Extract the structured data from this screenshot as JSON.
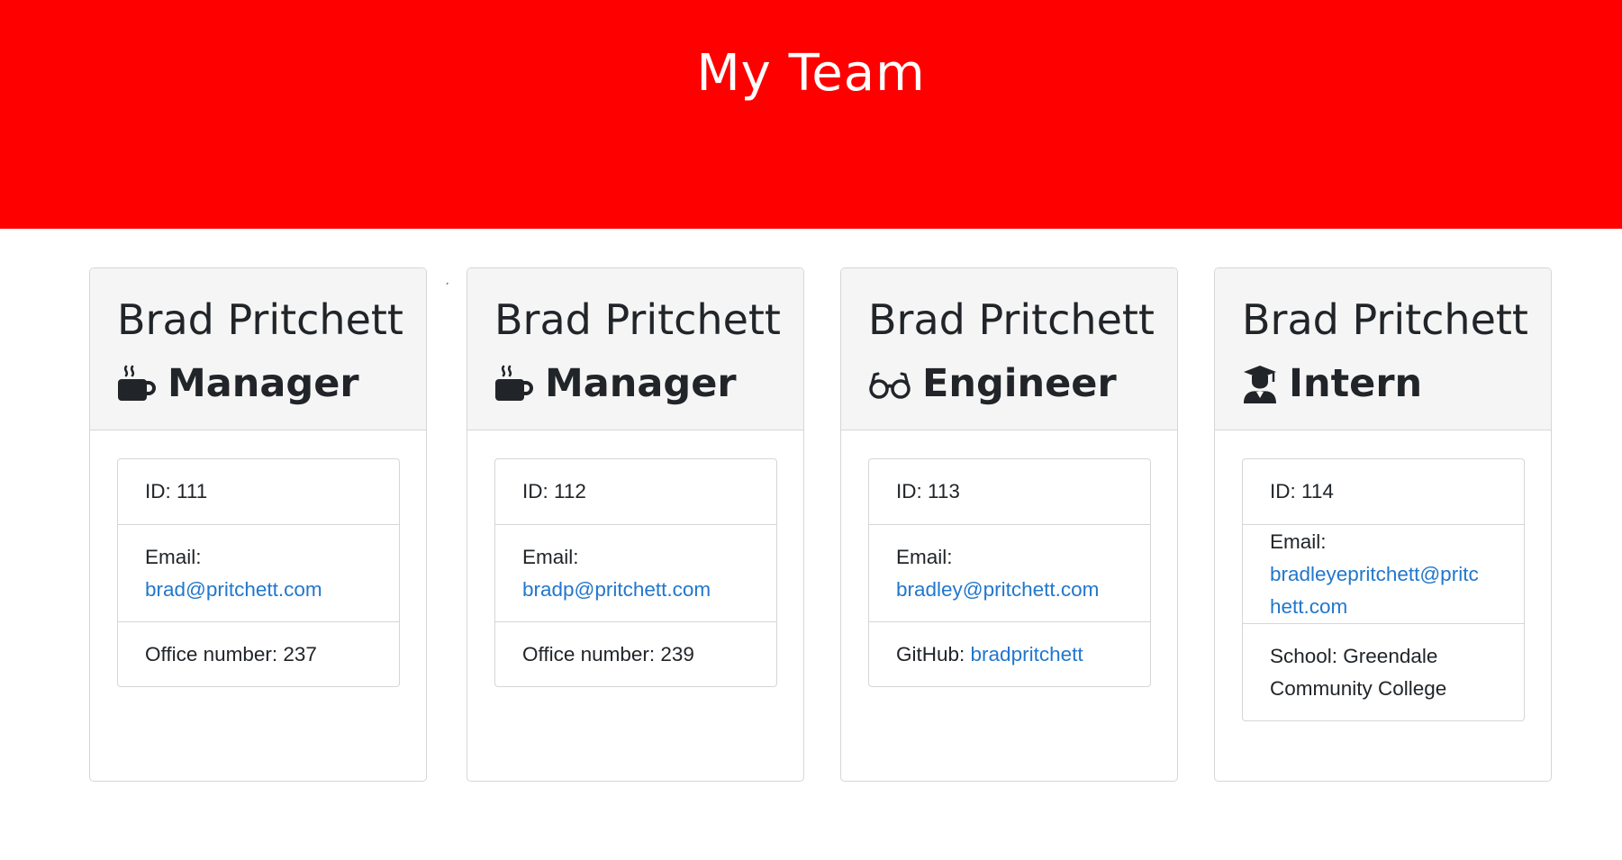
{
  "header": {
    "title": "My Team"
  },
  "stray_mark": "ˏ",
  "cards": [
    {
      "name": "Brad Pritchett",
      "role": "Manager",
      "role_icon": "coffee-mug-icon",
      "id": "ID: 111",
      "email_label": "Email:",
      "email": "brad@pritchett.com",
      "extra_label": "Office number: 237"
    },
    {
      "name": "Brad Pritchett",
      "role": "Manager",
      "role_icon": "coffee-mug-icon",
      "id": "ID: 112",
      "email_label": "Email:",
      "email": "bradp@pritchett.com",
      "extra_label": "Office number: 239"
    },
    {
      "name": "Brad Pritchett",
      "role": "Engineer",
      "role_icon": "glasses-icon",
      "id": "ID: 113",
      "email_label": "Email:",
      "email": "bradley@pritchett.com",
      "extra_label": "GitHub: ",
      "extra_link": "bradpritchett"
    },
    {
      "name": "Brad Pritchett",
      "role": "Intern",
      "role_icon": "graduate-icon",
      "id": "ID: 114",
      "email_label": "Email:",
      "email_line1": "bradleyepritchett@pritc",
      "email_line2": "hett.com",
      "school_line1": "School: Greendale",
      "school_line2": "Community College"
    }
  ],
  "colors": {
    "header_bg": "#ff0000",
    "link": "#2277cc",
    "card_header_bg": "#f5f5f5",
    "border": "#d6d6d6"
  }
}
